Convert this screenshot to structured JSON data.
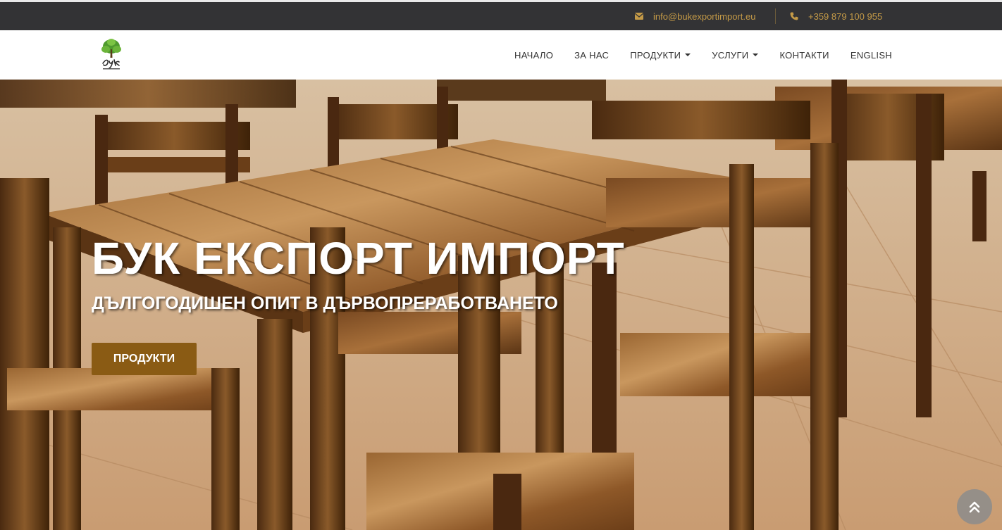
{
  "topbar": {
    "email": "info@bukexportimport.eu",
    "phone": "+359 879 100 955",
    "email_icon": "envelope-icon",
    "phone_icon": "phone-icon"
  },
  "nav": {
    "items": [
      {
        "label": "НАЧАЛО",
        "dropdown": false
      },
      {
        "label": "ЗА НАС",
        "dropdown": false
      },
      {
        "label": "ПРОДУКТИ",
        "dropdown": true
      },
      {
        "label": "УСЛУГИ",
        "dropdown": true
      },
      {
        "label": "КОНТАКТИ",
        "dropdown": false
      },
      {
        "label": "ENGLISH",
        "dropdown": false
      }
    ]
  },
  "logo": {
    "text": "Бук Export Import"
  },
  "hero": {
    "title": "БУК ЕКСПОРТ ИМПОРТ",
    "subtitle": "ДЪЛГОГОДИШЕН ОПИТ В ДЪРВОПРЕРАБОТВАНЕТО",
    "button_label": "ПРОДУКТИ",
    "scroll_icon": "double-chevron-up-icon"
  },
  "colors": {
    "topbar_bg": "#333335",
    "accent_gold": "#c49a47",
    "button_brown": "#8a5b14",
    "logo_green": "#4f9a2e"
  }
}
